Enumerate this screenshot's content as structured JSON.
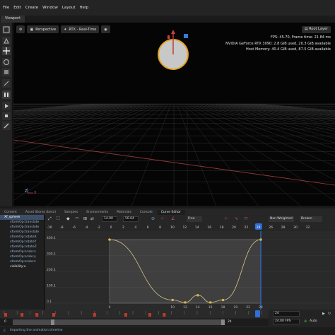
{
  "menu": [
    "File",
    "Edit",
    "Create",
    "Window",
    "Layout",
    "Help"
  ],
  "viewport": {
    "tab": "Viewport",
    "camera": "Perspective",
    "renderer": "RTX - Real-Time",
    "root_layer": "Root Layer",
    "stats": [
      "FPS: 45.70, Frame time: 21.84 ms",
      "NVIDIA GeForce RTX 3090: 2.8 GiB used, 20.3 GiB available",
      "Host Memory: 40.4 GiB used, 87.5 GiB available"
    ],
    "axis_z": "Z",
    "axis_x": "X"
  },
  "bottom_tabs": [
    "Content",
    "Asset Stores (beta)",
    "Samples",
    "Environments",
    "Materials",
    "Console",
    "Curve Editor"
  ],
  "active_tab": "Curve Editor",
  "tree": {
    "root": "Xf_sphere",
    "items": [
      "xformOp:translate",
      "xformOp:translate",
      "xformOp:translate",
      "xformOp:rotateX",
      "xformOp:rotateY",
      "xformOp:rotateZ",
      "xformOp:scale:x",
      "xformOp:scale:y",
      "xformOp:scale:z",
      "visibility:x"
    ]
  },
  "curve_editor": {
    "time_value": "14.00",
    "key_value": "50.64",
    "interp": "Free",
    "weight_mode": "Non-Weighted",
    "tangent_mode": "Broken",
    "ruler_ticks": [
      "-10",
      "-8",
      "-6",
      "-4",
      "-2",
      "0",
      "2",
      "4",
      "6",
      "8",
      "10",
      "12",
      "14",
      "16",
      "18",
      "20",
      "22",
      "24",
      "26",
      "28",
      "30",
      "32"
    ],
    "y_ticks": [
      "400.1",
      "300.1",
      "200.1",
      "100.1",
      "0.1"
    ],
    "x_ticks": [
      "0",
      "10",
      "12",
      "14",
      "16",
      "18",
      "20",
      "22",
      "24"
    ],
    "current_frame": "24",
    "keys": [
      {
        "t": 0,
        "v": 400
      },
      {
        "t": 10,
        "v": 20
      },
      {
        "t": 12,
        "v": 5
      },
      {
        "t": 14,
        "v": 50
      },
      {
        "t": 16,
        "v": 5
      },
      {
        "t": 18,
        "v": 20
      },
      {
        "t": 24,
        "v": 400
      }
    ]
  },
  "timeline": {
    "ticks": [
      "0",
      "5",
      "10",
      "15",
      "20",
      "25",
      "30",
      "35",
      "40",
      "45",
      "50",
      "55",
      "60",
      "65",
      "70",
      "75",
      "80",
      "85",
      "90",
      "95",
      "100"
    ],
    "start": "0",
    "end": "24",
    "current": "24",
    "end_field": "24",
    "fps": "24.00 FPS",
    "auto": "Auto",
    "start_field": "0"
  },
  "status": "Importing the animation timeline",
  "colors": {
    "accent": "#2f6fd6",
    "curve": "#d8c790",
    "key": "#d6b34a",
    "keymark": "#c0392b"
  }
}
